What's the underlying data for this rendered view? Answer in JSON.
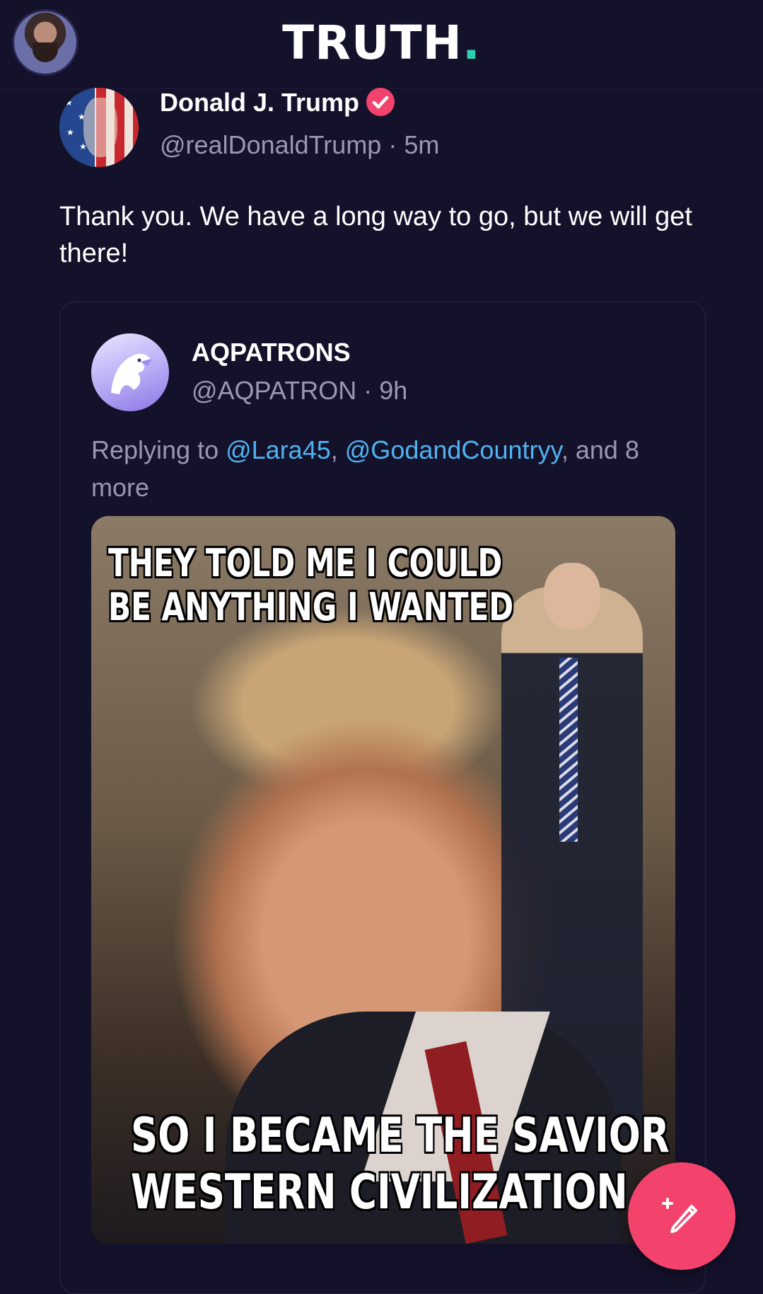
{
  "header": {
    "logo_text": "TRUTH",
    "logo_dot": ".",
    "logo_dot_color": "#2fd0b0"
  },
  "post": {
    "author_name": "Donald J. Trump",
    "handle": "@realDonaldTrump",
    "separator": "·",
    "time": "5m",
    "text": "Thank you. We have a long way to go, but we will get there!",
    "verified_icon": "verified-badge-icon"
  },
  "quoted_post": {
    "author_name": "AQPATRONS",
    "handle": "@AQPATRON",
    "separator": "·",
    "time": "9h",
    "replying_prefix": "Replying to ",
    "mentions": [
      "@Lara45",
      "@GodandCountryy"
    ],
    "comma": ", ",
    "replying_suffix": ", and 8 more",
    "meme": {
      "caption_top_line1": "THEY TOLD ME I COULD",
      "caption_top_line2": "BE ANYTHING I WANTED",
      "caption_bottom_line1": "SO I BECAME THE SAVIOR OF",
      "caption_bottom_line2": "WESTERN CIVILIZATION"
    }
  },
  "fab": {
    "icon": "compose-icon",
    "color": "#f3436d"
  },
  "colors": {
    "background": "#14112b",
    "muted_text": "#9a98b0",
    "mention": "#4fb3f0",
    "verified": "#f2436d"
  }
}
